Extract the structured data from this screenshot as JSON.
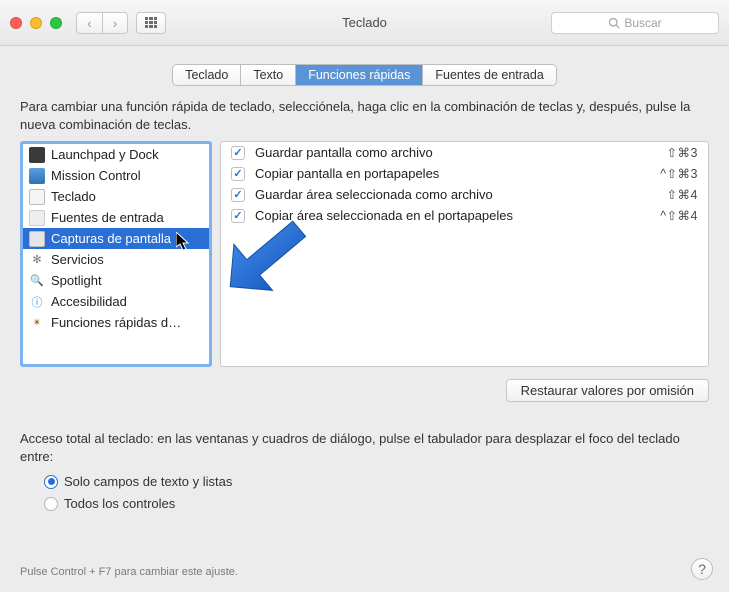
{
  "window": {
    "title": "Teclado"
  },
  "search": {
    "placeholder": "Buscar"
  },
  "tabs": [
    {
      "label": "Teclado",
      "active": false
    },
    {
      "label": "Texto",
      "active": false
    },
    {
      "label": "Funciones rápidas",
      "active": true
    },
    {
      "label": "Fuentes de entrada",
      "active": false
    }
  ],
  "intro": "Para cambiar una función rápida de teclado, selecciónela, haga clic en la combinación de teclas y, después, pulse la nueva combinación de teclas.",
  "categories": [
    {
      "label": "Launchpad y Dock",
      "icon": "launchpad-icon",
      "selected": false
    },
    {
      "label": "Mission Control",
      "icon": "mission-control-icon",
      "selected": false
    },
    {
      "label": "Teclado",
      "icon": "keyboard-icon",
      "selected": false
    },
    {
      "label": "Fuentes de entrada",
      "icon": "input-sources-icon",
      "selected": false
    },
    {
      "label": "Capturas de pantalla",
      "icon": "screenshot-icon",
      "selected": true
    },
    {
      "label": "Servicios",
      "icon": "gear-icon",
      "selected": false
    },
    {
      "label": "Spotlight",
      "icon": "spotlight-icon",
      "selected": false
    },
    {
      "label": "Accesibilidad",
      "icon": "accessibility-icon",
      "selected": false
    },
    {
      "label": "Funciones rápidas d…",
      "icon": "app-shortcuts-icon",
      "selected": false
    }
  ],
  "shortcuts": [
    {
      "label": "Guardar pantalla como archivo",
      "keys": "⇧⌘3",
      "checked": true
    },
    {
      "label": "Copiar pantalla en portapapeles",
      "keys": "^⇧⌘3",
      "checked": true
    },
    {
      "label": "Guardar área seleccionada como archivo",
      "keys": "⇧⌘4",
      "checked": true
    },
    {
      "label": "Copiar área seleccionada en el portapapeles",
      "keys": "^⇧⌘4",
      "checked": true
    }
  ],
  "restore_button": "Restaurar valores por omisión",
  "access": {
    "text": "Acceso total al teclado: en las ventanas y cuadros de diálogo, pulse el tabulador para desplazar el foco del teclado entre:",
    "options": [
      {
        "label": "Solo campos de texto y listas",
        "selected": true
      },
      {
        "label": "Todos los controles",
        "selected": false
      }
    ]
  },
  "footnote": "Pulse Control + F7 para cambiar este ajuste."
}
